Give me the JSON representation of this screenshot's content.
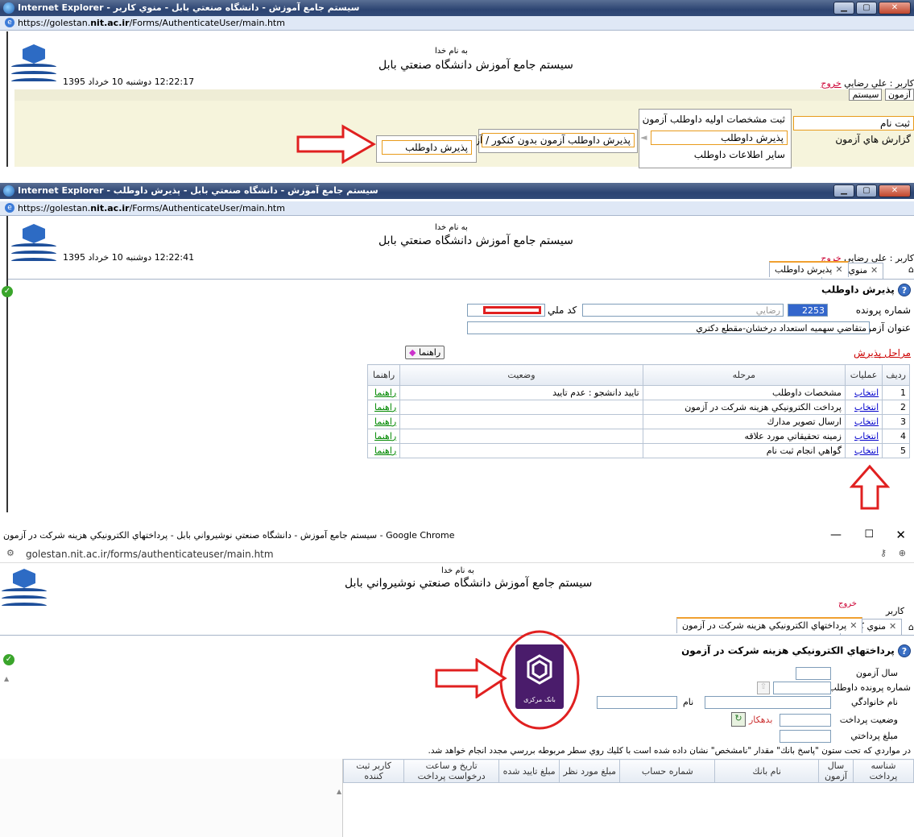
{
  "window1": {
    "title": "Internet Explorer - سيستم جامع آموزش - دانشگاه صنعتي بابل - منوي كاربر",
    "url_prefix": "https://golestan.",
    "url_domain": "nit.ac.ir",
    "url_path": "/Forms/AuthenticateUser/main.htm",
    "header_top": "به نام خدا",
    "header_title": "سیستم جامع آموزش   دانشگاه صنعتي بابل",
    "datetime": "12:22:17 دوشنبه 10 خرداد 1395",
    "user": "كاربر : علي رضايي",
    "logout": "خروج",
    "btn_system": "سيستم",
    "btn_azmoon": "آزمون",
    "menu_col1": [
      "ثبت نام",
      "گزارش هاي آزمون"
    ],
    "menu_col2": [
      "ثبت مشخصات اوليه داوطلب آزمون",
      "پذيرش داوطلب",
      "ساير اطلاعات داوطلب"
    ],
    "menu_col3": [
      "پذيرش داوطلب آزمون بدون كنكور / آزاد"
    ],
    "menu_col4": [
      "پذيرش داوطلب"
    ]
  },
  "window2": {
    "title": "Internet Explorer - سيستم جامع آموزش - دانشگاه صنعتي بابل - پذيرش داوطلب",
    "url_prefix": "https://golestan.",
    "url_domain": "nit.ac.ir",
    "url_path": "/Forms/AuthenticateUser/main.htm",
    "header_top": "به نام خدا",
    "header_title": "سیستم جامع آموزش   دانشگاه صنعتي بابل",
    "datetime": "12:22:41 دوشنبه 10 خرداد 1395",
    "user": "كاربر : علي رضايي",
    "logout": "خروج",
    "tabs": [
      "منوي كاربر",
      "پذيرش داوطلب"
    ],
    "page_title": "پذيرش داوطلب",
    "label_file_no": "شماره پرونده",
    "file_no": "2253",
    "lastname": "رضايي",
    "label_national_id": "كد ملي",
    "label_exam_title": "عنوان آزمون",
    "exam_title": "متقاضي سهميه استعداد درخشان-مقطع دكتري",
    "stages_link": "مراحل پذيرش",
    "help_button": "راهنما",
    "columns": [
      "رديف",
      "عمليات",
      "مرحله",
      "وضعيت",
      "راهنما"
    ],
    "rows": [
      {
        "n": "1",
        "op": "انتخاب",
        "stage": "مشخصات داوطلب",
        "status": "تاييد دانشجو : عدم تاييد",
        "help": "راهنما"
      },
      {
        "n": "2",
        "op": "انتخاب",
        "stage": "پرداخت الكترونيكي هزينه شركت در آزمون",
        "status": "",
        "help": "راهنما"
      },
      {
        "n": "3",
        "op": "انتخاب",
        "stage": "ارسال تصوير مدارك",
        "status": "",
        "help": "راهنما"
      },
      {
        "n": "4",
        "op": "انتخاب",
        "stage": "زمينه تحقيقاتي مورد علاقه",
        "status": "",
        "help": "راهنما"
      },
      {
        "n": "5",
        "op": "انتخاب",
        "stage": "گواهي انجام ثبت نام",
        "status": "",
        "help": "راهنما"
      }
    ]
  },
  "window3": {
    "title": "سيستم جامع آموزش - دانشگاه صنعتي نوشيرواني بابل - پرداختهاي الكترونيكي هزينه شركت در آزمون - Google Chrome",
    "url": "golestan.nit.ac.ir/forms/authenticateuser/main.htm",
    "header_top": "به نام خدا",
    "header_title": "سیستم جامع آموزش   دانشگاه صنعتي نوشيرواني بابل",
    "user": "كاربر",
    "logout": "خروج",
    "tabs": [
      "منوي كاربر",
      "پرداختهاي الكترونيكي هزينه شركت در آزمون"
    ],
    "page_title": "پرداختهاي الكترونيكي هزينه شركت در آزمون",
    "label_year": "سال آزمون",
    "label_file_no": "شماره پرونده داوطلب",
    "label_lastname": "نام خانوادگي",
    "label_name": "نام",
    "label_pay_status": "وضعيت پرداخت",
    "debtor": "بدهكار",
    "label_amount": "مبلغ پرداختي",
    "notice": "در مواردي كه تحت ستون \"پاسخ بانك\" مقدار \"نامشخص\" نشان داده شده است با كليك روي سطر مربوطه بررسي مجدد انجام خواهد شد.",
    "bank_logo_text": "بانک مرکزی",
    "columns": [
      "شناسه پرداخت",
      "سال آزمون",
      "نام بانك",
      "شماره حساب",
      "مبلغ مورد نظر",
      "مبلغ تاييد شده",
      "تاريخ و ساعت درخواست پرداخت",
      "كاربر ثبت كننده"
    ]
  },
  "colors": {
    "accent_red": "#e02020",
    "menu_highlight": "#e89b1c"
  }
}
